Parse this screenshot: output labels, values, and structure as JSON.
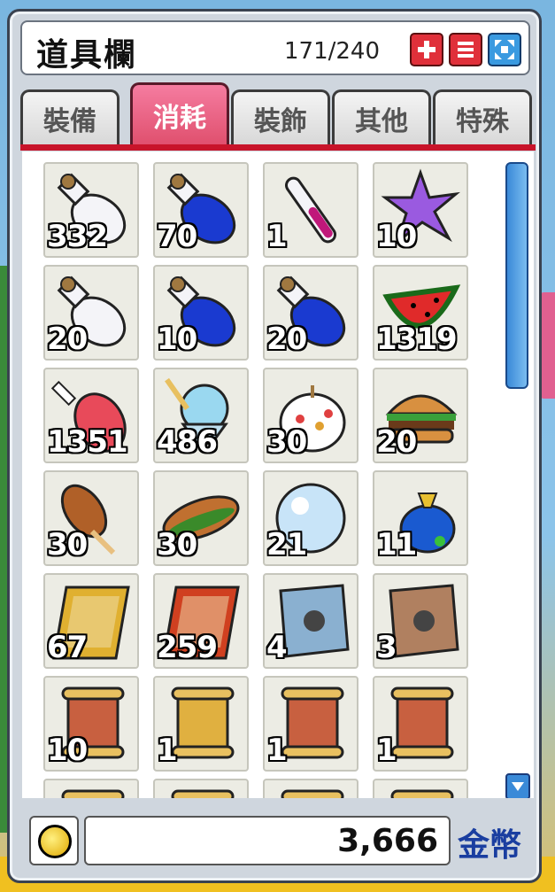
{
  "window": {
    "title": "道具欄",
    "capacity": "171/240"
  },
  "title_buttons": [
    {
      "name": "add-button",
      "icon": "plus-icon"
    },
    {
      "name": "menu-button",
      "icon": "list-icon"
    },
    {
      "name": "expand-button",
      "icon": "expand-icon"
    }
  ],
  "tabs": [
    {
      "label": "裝備",
      "active": false
    },
    {
      "label": "消耗",
      "active": true
    },
    {
      "label": "裝飾",
      "active": false
    },
    {
      "label": "其他",
      "active": false
    },
    {
      "label": "特殊",
      "active": false
    }
  ],
  "items": [
    {
      "icon": "white-potion-icon",
      "count": "332"
    },
    {
      "icon": "blue-potion-icon",
      "count": "70"
    },
    {
      "icon": "pink-test-tube-icon",
      "count": "1"
    },
    {
      "icon": "purple-spiky-crystal-icon",
      "count": "10"
    },
    {
      "icon": "white-potion-icon",
      "count": "20"
    },
    {
      "icon": "blue-potion-icon",
      "count": "10"
    },
    {
      "icon": "blue-elixir-icon",
      "count": "20"
    },
    {
      "icon": "watermelon-icon",
      "count": "1319"
    },
    {
      "icon": "meat-drumstick-icon",
      "count": "1351"
    },
    {
      "icon": "ice-cream-sundae-icon",
      "count": "486"
    },
    {
      "icon": "cake-icon",
      "count": "30"
    },
    {
      "icon": "hamburger-icon",
      "count": "20"
    },
    {
      "icon": "corn-dog-icon",
      "count": "30"
    },
    {
      "icon": "hot-dog-icon",
      "count": "30"
    },
    {
      "icon": "snowball-icon",
      "count": "21"
    },
    {
      "icon": "blue-gift-bag-icon",
      "count": "11"
    },
    {
      "icon": "gold-skill-card-icon",
      "count": "67"
    },
    {
      "icon": "red-skill-card-icon",
      "count": "259"
    },
    {
      "icon": "blue-map-scroll-icon",
      "count": "4"
    },
    {
      "icon": "brown-map-scroll-icon",
      "count": "3"
    },
    {
      "icon": "red-scroll-icon",
      "count": "10"
    },
    {
      "icon": "yellow-scroll-icon",
      "count": "1"
    },
    {
      "icon": "red-scroll-icon",
      "count": "1"
    },
    {
      "icon": "red-scroll-icon",
      "count": "1"
    },
    {
      "icon": "yellow-scroll-icon",
      "count": ""
    },
    {
      "icon": "red-scroll-icon",
      "count": ""
    },
    {
      "icon": "blue-scroll-icon",
      "count": ""
    },
    {
      "icon": "yellow-scroll-icon",
      "count": ""
    }
  ],
  "footer": {
    "coin_icon": "gold-coin-icon",
    "gold_amount": "3,666",
    "currency_label": "金幣"
  },
  "colors": {
    "active_tab": "#e0506e",
    "tab_underline": "#c8142a",
    "scrollbar": "#3a8ad8",
    "currency_label": "#1a3ea0"
  }
}
